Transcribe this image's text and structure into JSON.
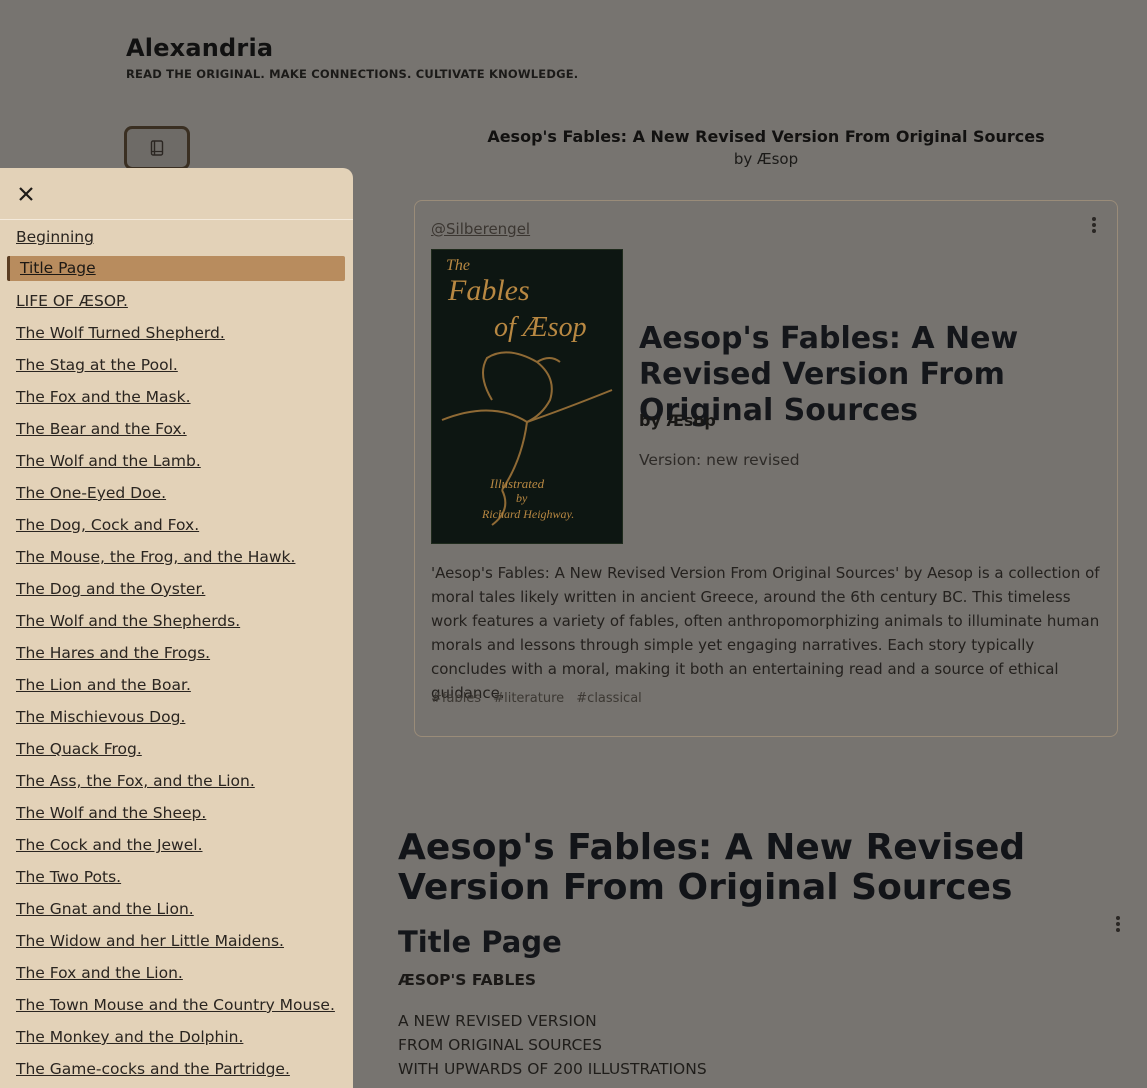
{
  "site": {
    "title": "Alexandria",
    "tagline": "READ THE ORIGINAL. MAKE CONNECTIONS. CULTIVATE KNOWLEDGE."
  },
  "book_heading": {
    "title": "Aesop's Fables: A New Revised Version From Original Sources",
    "author_line": "by Æsop"
  },
  "card": {
    "user": "@Silberengel",
    "cover": {
      "line1": "The",
      "line2": "Fables",
      "line3": "of Æsop",
      "line4": "Illustrated",
      "line5": "by",
      "line6": "Richard Heighway."
    },
    "title": "Aesop's Fables: A New Revised Version From Original Sources",
    "author": "by Æsop",
    "version": "Version: new revised",
    "description": "'Aesop's Fables: A New Revised Version From Original Sources' by Aesop is a collection of moral tales likely written in ancient Greece, around the 6th century BC. This timeless work features a variety of fables, often anthropomorphizing animals to illuminate human morals and lessons through simple yet engaging narratives. Each story typically concludes with a moral, making it both an entertaining read and a source of ethical guidance.",
    "tags": [
      "#fables",
      "#literature",
      "#classical"
    ]
  },
  "content": {
    "h1": "Aesop's Fables: A New Revised Version From Original Sources",
    "h2": "Title Page",
    "caps": "ÆSOP'S FABLES",
    "lines": [
      "A NEW REVISED VERSION",
      "FROM ORIGINAL SOURCES",
      "WITH UPWARDS OF 200 ILLUSTRATIONS"
    ]
  },
  "toc": {
    "active_index": 1,
    "items": [
      "Beginning",
      "Title Page",
      "LIFE OF ÆSOP.",
      "The Wolf Turned Shepherd.",
      "The Stag at the Pool.",
      "The Fox and the Mask.",
      "The Bear and the Fox.",
      "The Wolf and the Lamb.",
      "The One-Eyed Doe.",
      "The Dog, Cock and Fox.",
      "The Mouse, the Frog, and the Hawk.",
      "The Dog and the Oyster.",
      "The Wolf and the Shepherds.",
      "The Hares and the Frogs.",
      "The Lion and the Boar.",
      "The Mischievous Dog.",
      "The Quack Frog.",
      "The Ass, the Fox, and the Lion.",
      "The Wolf and the Sheep.",
      "The Cock and the Jewel.",
      "The Two Pots.",
      "The Gnat and the Lion.",
      "The Widow and her Little Maidens.",
      "The Fox and the Lion.",
      "The Town Mouse and the Country Mouse.",
      "The Monkey and the Dolphin.",
      "The Game-cocks and the Partridge."
    ]
  },
  "icons": {
    "toc_toggle": "book-icon",
    "close": "close-icon",
    "menu": "kebab-menu-icon"
  }
}
